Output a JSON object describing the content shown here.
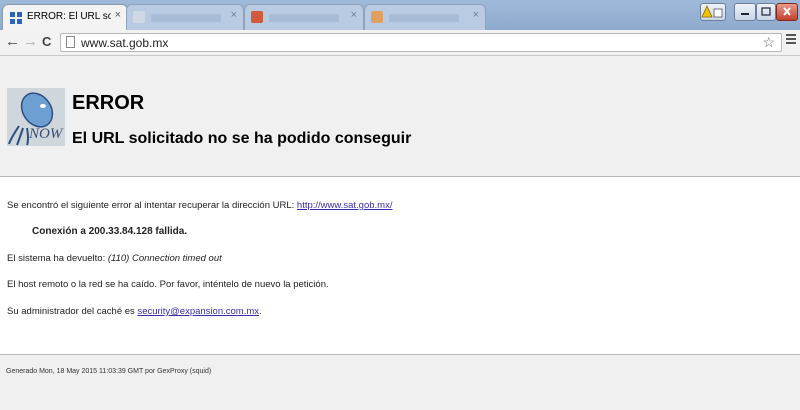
{
  "browser": {
    "active_tab_title": "ERROR: El URL solicitado r",
    "tab_close": "×",
    "url": "www.sat.gob.mx",
    "back_icon": "←",
    "forward_icon": "→",
    "reload_icon": "C",
    "star_icon": "☆",
    "background_tabs": [
      {
        "title": "",
        "color": "#cfd9e6"
      },
      {
        "title": "",
        "color": "#d05a3a"
      },
      {
        "title": "",
        "color": "#e0a060"
      }
    ]
  },
  "error": {
    "title": "ERROR",
    "subtitle": "El URL solicitado no se ha podido conseguir"
  },
  "content": {
    "line1_prefix": "Se encontró el siguiente error al intentar recuperar la dirección URL: ",
    "line1_link": "http://www.sat.gob.mx/",
    "line2": "Conexión a 200.33.84.128 fallida.",
    "line3_prefix": "El sistema ha devuelto: ",
    "line3_em": "(110) Connection timed out",
    "line4": "El host remoto o la red se ha caído. Por favor, inténtelo de nuevo la petición.",
    "line5_prefix": "Su administrador del caché es ",
    "line5_link": "security@expansion.com.mx",
    "line5_suffix": "."
  },
  "footer": {
    "text": "Generado Mon, 18 May 2015 11:03:39 GMT por GexProxy (squid)"
  }
}
